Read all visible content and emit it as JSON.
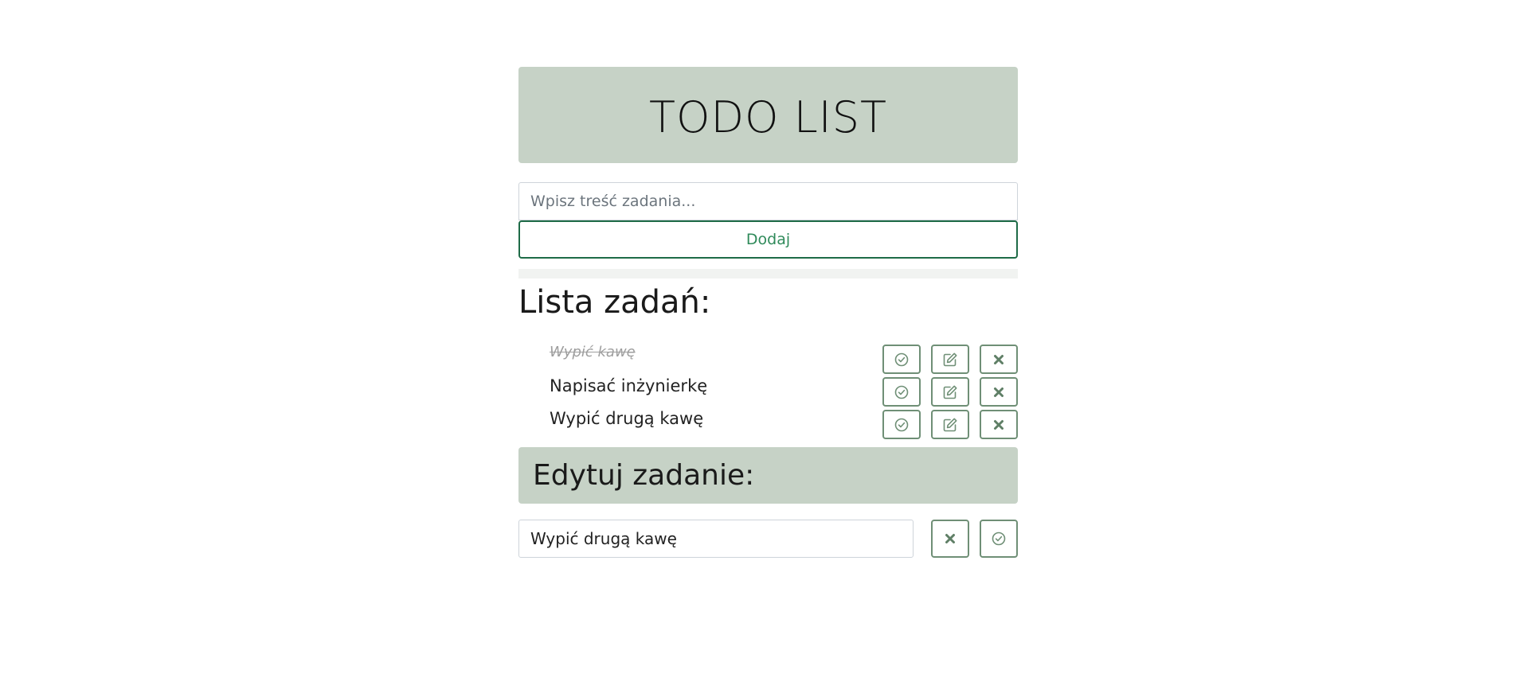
{
  "app": {
    "title": "TODO LIST"
  },
  "new_task": {
    "placeholder": "Wpisz treść zadania...",
    "value": "",
    "add_label": "Dodaj"
  },
  "list": {
    "title": "Lista zadań:",
    "tasks": [
      {
        "text": "Wypić kawę",
        "done": true
      },
      {
        "text": "Napisać inżynierkę",
        "done": false
      },
      {
        "text": "Wypić drugą kawę",
        "done": false
      }
    ]
  },
  "edit": {
    "title": "Edytuj zadanie:",
    "value": "Wypić drugą kawę"
  },
  "icons": {
    "complete": "check-circle-icon",
    "edit": "pencil-square-icon",
    "delete": "x-icon"
  },
  "colors": {
    "header_bg": "#c6d2c6",
    "accent": "#1e6b47",
    "icon_border": "#6f8f76"
  }
}
